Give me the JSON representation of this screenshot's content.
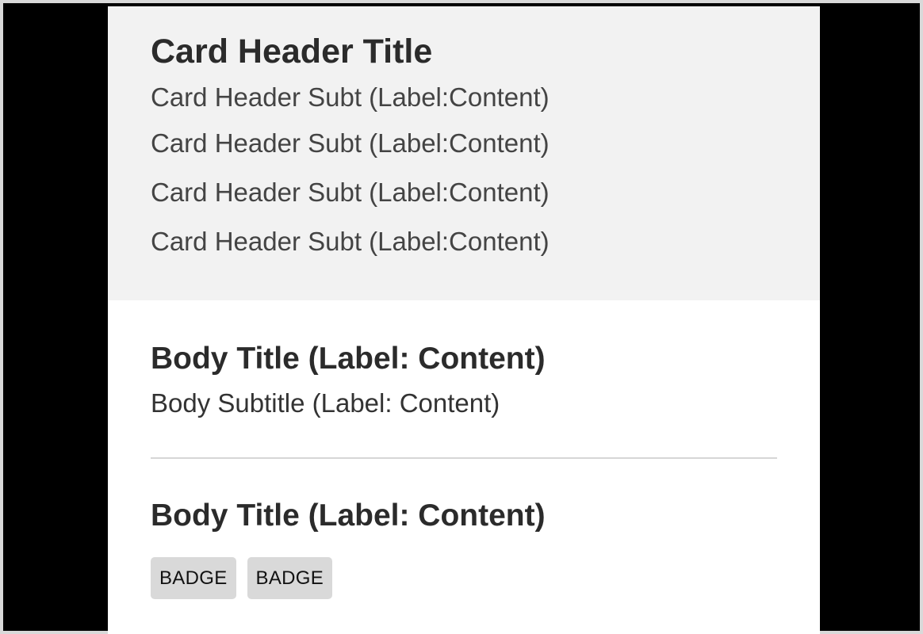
{
  "header": {
    "title": "Card Header Title",
    "subtitles": [
      "Card Header Subt (Label:Content)",
      "Card Header Subt (Label:Content)",
      "Card Header Subt (Label:Content)",
      "Card Header Subt (Label:Content)"
    ]
  },
  "body": {
    "sections": [
      {
        "title": "Body Title (Label: Content)",
        "subtitle": "Body Subtitle (Label: Content)"
      },
      {
        "title": "Body Title (Label: Content)",
        "badges": [
          "BADGE",
          "BADGE"
        ]
      }
    ]
  },
  "colors": {
    "header_background": "#f2f2f2",
    "page_background": "#000000",
    "badge_background": "#d9d9d9"
  }
}
